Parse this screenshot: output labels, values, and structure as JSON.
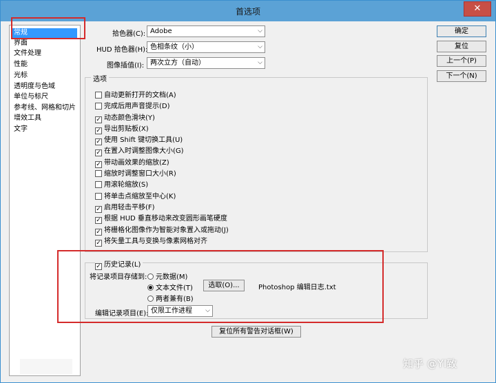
{
  "window": {
    "title": "首选项",
    "close_glyph": "✕"
  },
  "sidebar": {
    "items": [
      {
        "label": "常规",
        "selected": true
      },
      {
        "label": "界面"
      },
      {
        "label": "文件处理"
      },
      {
        "label": "性能"
      },
      {
        "label": "光标"
      },
      {
        "label": "透明度与色域"
      },
      {
        "label": "单位与标尺"
      },
      {
        "label": "参考线、网格和切片"
      },
      {
        "label": "增效工具"
      },
      {
        "label": "文字"
      }
    ]
  },
  "general": {
    "color_picker_label": "拾色器(C):",
    "color_picker_value": "Adobe",
    "hud_label": "HUD 拾色器(H):",
    "hud_value": "色相条纹（小）",
    "interp_label": "图像插值(I):",
    "interp_value": "两次立方（自动）"
  },
  "options": {
    "title": "选项",
    "items": [
      {
        "label": "自动更新打开的文档(A)",
        "checked": false
      },
      {
        "label": "完成后用声音提示(D)",
        "checked": false
      },
      {
        "label": "动态颜色滑块(Y)",
        "checked": true
      },
      {
        "label": "导出剪贴板(X)",
        "checked": true
      },
      {
        "label": "使用 Shift 键切换工具(U)",
        "checked": true
      },
      {
        "label": "在置入时调整图像大小(G)",
        "checked": true
      },
      {
        "label": "带动画效果的缩放(Z)",
        "checked": true
      },
      {
        "label": "缩放时调整窗口大小(R)",
        "checked": false
      },
      {
        "label": "用滚轮缩放(S)",
        "checked": false
      },
      {
        "label": "将单击点缩放至中心(K)",
        "checked": false
      },
      {
        "label": "启用轻击平移(F)",
        "checked": true
      },
      {
        "label": "根据 HUD 垂直移动来改变圆形画笔硬度",
        "checked": true
      },
      {
        "label": "将栅格化图像作为智能对象置入或拖动(J)",
        "checked": true
      },
      {
        "label": "将矢量工具与变换与像素网格对齐",
        "checked": true
      }
    ]
  },
  "history": {
    "checkbox_label": "历史记录(L)",
    "checked": true,
    "save_to_label": "将记录项目存储到:",
    "radio_metadata": "元数据(M)",
    "radio_textfile": "文本文件(T)",
    "radio_both": "两者兼有(B)",
    "choose_button": "选取(O)...",
    "file_name": "Photoshop 编辑日志.txt",
    "edit_log_label": "编辑记录项目(E):",
    "edit_log_value": "仅限工作进程"
  },
  "reset_warnings_button": "复位所有警告对话框(W)",
  "buttons": {
    "ok": "确定",
    "reset": "复位",
    "prev": "上一个(P)",
    "next": "下一个(N)"
  },
  "watermark": "知乎 @YI致",
  "colors": {
    "accent": "#5ba2d6",
    "selection": "#3399ff",
    "highlight_box": "#d42a2a"
  }
}
